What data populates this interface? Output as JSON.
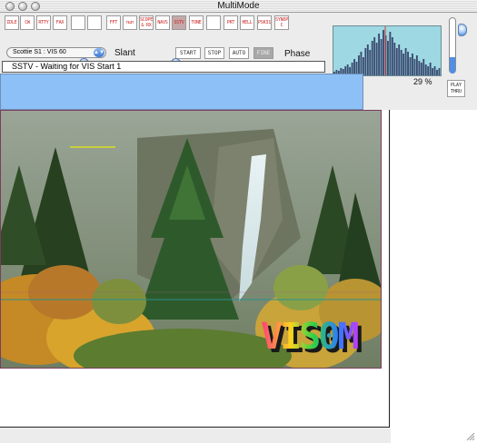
{
  "window": {
    "title": "MultiMode"
  },
  "modes": [
    {
      "label": "IDLE",
      "active": false
    },
    {
      "label": "CW",
      "active": false
    },
    {
      "label": "RTTY",
      "active": false
    },
    {
      "label": "FAX",
      "active": false
    },
    {
      "label": "",
      "active": false
    },
    {
      "label": "",
      "active": false
    },
    {
      "label": "FFT",
      "active": false
    },
    {
      "label": "⊓⊔⊓",
      "active": false
    },
    {
      "label": "SCOPE",
      "label2": "& RX",
      "active": false
    },
    {
      "label": "NAVS",
      "active": false
    },
    {
      "label": "SSTV",
      "active": true
    },
    {
      "label": "TONE",
      "active": false
    },
    {
      "label": "",
      "active": false
    },
    {
      "label": "PKT",
      "active": false
    },
    {
      "label": "HELL",
      "active": false
    },
    {
      "label": "PSK31",
      "active": false
    },
    {
      "label": "SYNOP",
      "label2": "C",
      "active": false
    }
  ],
  "sstv": {
    "mode_value": "Scottie S1 : VIS 60",
    "slant_label": "Slant",
    "phase_label": "Phase",
    "start_label": "START",
    "stop_label": "STOP",
    "auto_label": "AUTO",
    "fine_label": "FINE",
    "slant_level": 0.55,
    "phase_level": 0.1
  },
  "status": {
    "text": "SSTV - Waiting for VIS Start  1"
  },
  "level": {
    "percent_text": "29 %",
    "value": 0.29
  },
  "playthru": {
    "label1": "PLAY",
    "label2": "THRU"
  },
  "picture": {
    "overlay_text": "VIS0M"
  },
  "colors": {
    "spectrum_bg": "#9ed8e2",
    "spectrum_bars": "#3a4a70",
    "status_blue": "#8cc0f7",
    "mode_text": "#cc1f1f"
  }
}
